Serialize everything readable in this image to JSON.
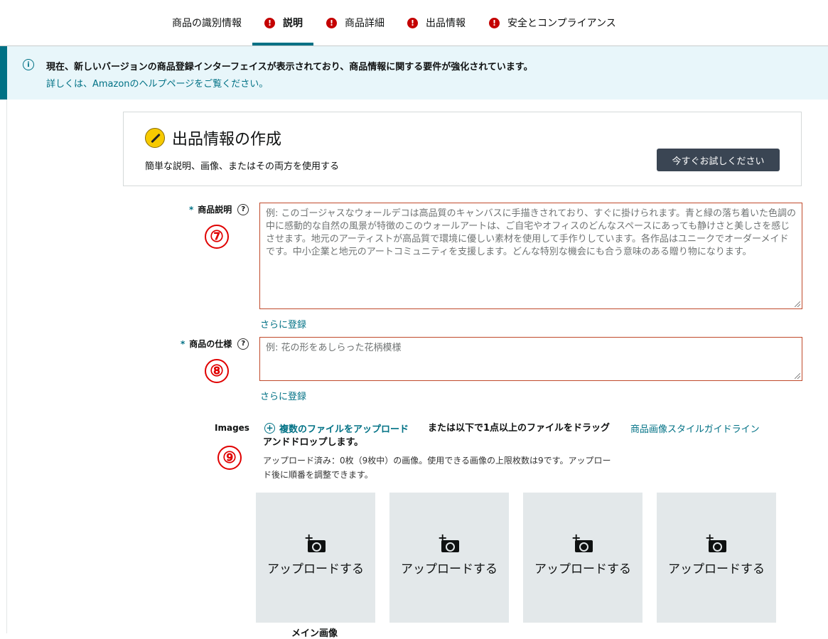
{
  "tabs": [
    {
      "label": "商品の識別情報",
      "alert": false,
      "active": false
    },
    {
      "label": "説明",
      "alert": true,
      "active": true
    },
    {
      "label": "商品詳細",
      "alert": true,
      "active": false
    },
    {
      "label": "出品情報",
      "alert": true,
      "active": false
    },
    {
      "label": "安全とコンプライアンス",
      "alert": true,
      "active": false
    }
  ],
  "banner": {
    "message": "現在、新しいバージョンの商品登録インターフェイスが表示されており、商品情報に関する要件が強化されています。",
    "link": "詳しくは、Amazonのヘルプページをご覧ください。"
  },
  "listing_card": {
    "title": "出品情報の作成",
    "subtitle": "簡単な説明、画像、またはその両方を使用する",
    "button": "今すぐお試しください"
  },
  "description": {
    "required_mark": "*",
    "label": "商品説明",
    "marker": "⑦",
    "placeholder": "例: このゴージャスなウォールデコは高品質のキャンバスに手描きされており、すぐに掛けられます。青と緑の落ち着いた色調の中に感動的な自然の風景が特徴のこのウォールアートは、ご自宅やオフィスのどんなスペースにあっても静けさと美しさを感じさせます。地元のアーティストが高品質で環境に優しい素材を使用して手作りしています。各作品はユニークでオーダーメイドです。中小企業と地元のアートコミュニティを支援します。どんな特別な機会にも合う意味のある贈り物になります。",
    "more_link": "さらに登録"
  },
  "specs": {
    "required_mark": "*",
    "label": "商品の仕様",
    "marker": "⑧",
    "placeholder": "例: 花の形をあしらった花柄模様",
    "more_link": "さらに登録"
  },
  "images": {
    "label": "Images",
    "marker": "⑨",
    "upload_multiple": "複数のファイルをアップロード",
    "drag_text": "または以下で1点以上のファイルをドラッグアンドドロップします。",
    "style_guide": "商品画像スタイルガイドライン",
    "uploaded_note": "アップロード済み：0枚（9枚中）の画像。使用できる画像の上限枚数は9です。アップロード後に順番を調整できます。",
    "slots": [
      "アップロードする",
      "アップロードする",
      "アップロードする",
      "アップロードする"
    ],
    "main_caption": "メイン画像"
  },
  "colors": {
    "accent": "#007185",
    "alert": "#c40000",
    "marker": "#e00000",
    "button_bg": "#3a4553",
    "banner_bg": "#e8f6fa",
    "slot_bg": "#e3e8ea"
  }
}
